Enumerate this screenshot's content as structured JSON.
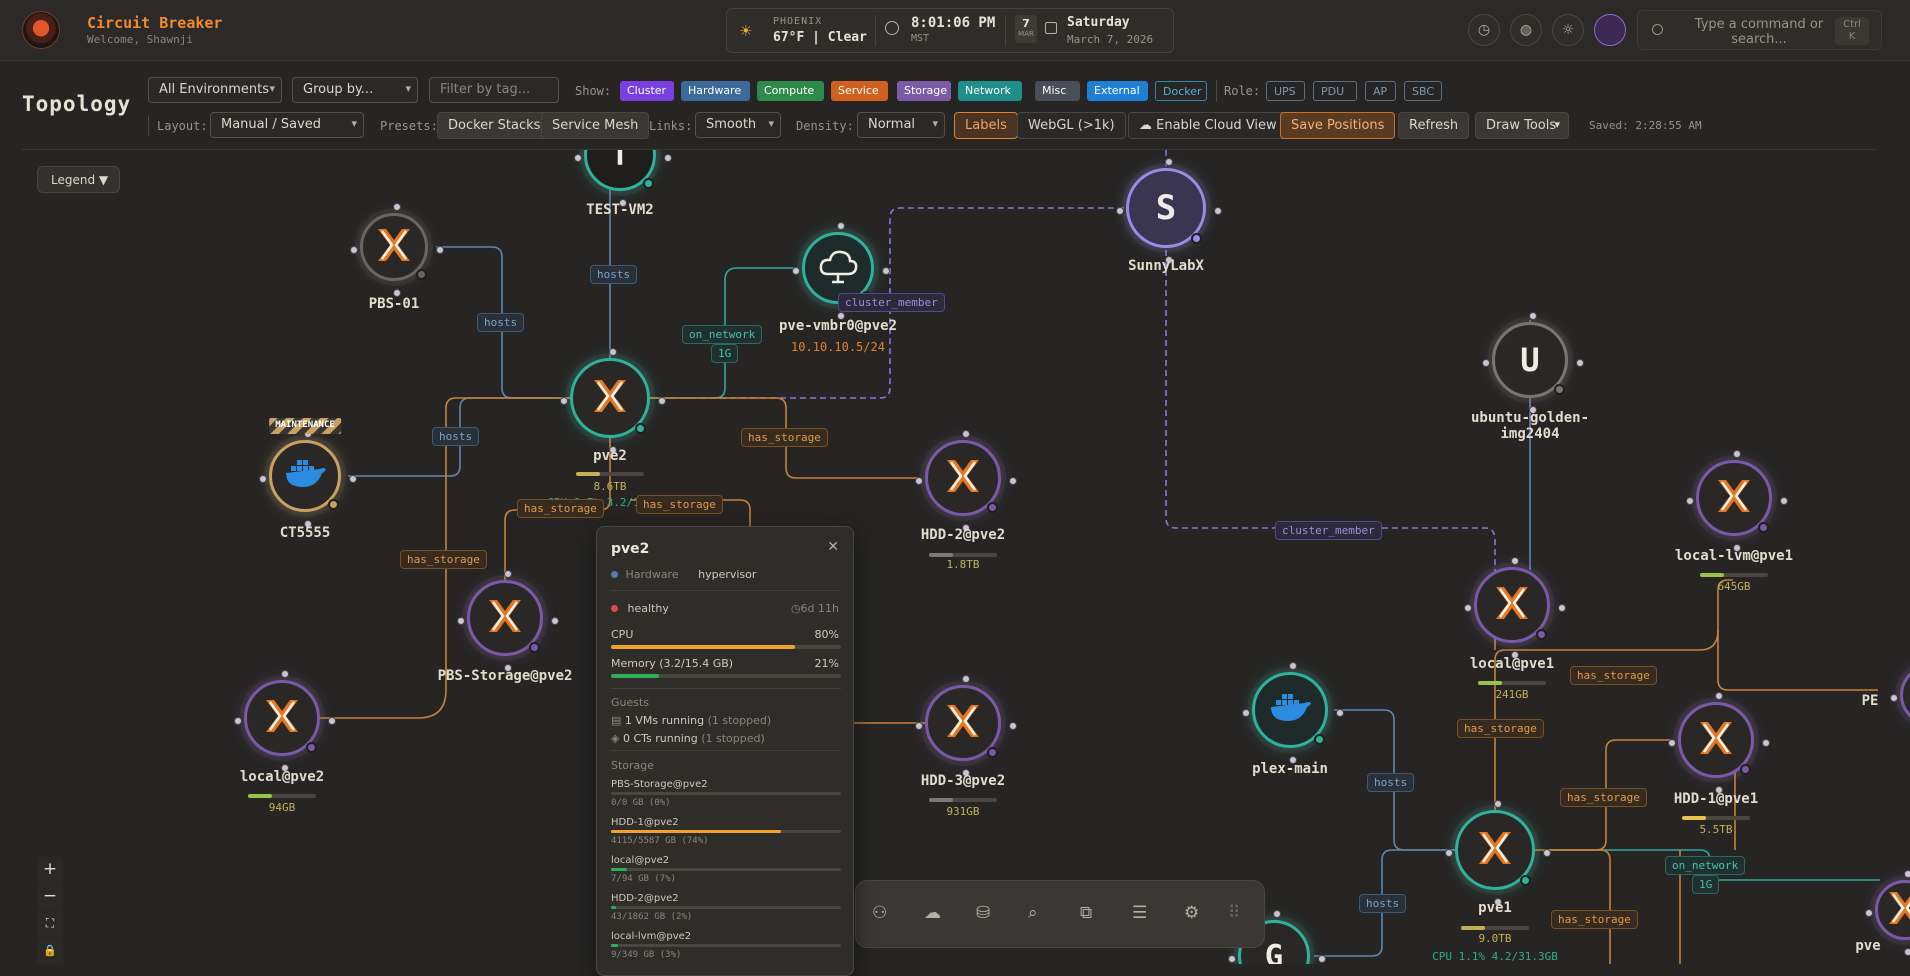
{
  "header": {
    "app_title": "Circuit Breaker",
    "welcome": "Welcome, Shawnji",
    "weather_city": "PHOENIX",
    "weather_line": "67°F | Clear",
    "clock_time": "8:01:06 PM",
    "clock_zone": "MST",
    "date_day_num": "7",
    "date_month_abbr": "MAR",
    "date_weekday": "Saturday",
    "date_full": "March 7, 2026",
    "command_placeholder": "Type a command or search...",
    "command_shortcut_1": "Ctrl",
    "command_shortcut_2": "K"
  },
  "toolbar": {
    "page_title": "Topology",
    "environment_select": "All Environments",
    "group_select": "Group by...",
    "tag_filter_placeholder": "Filter by tag...",
    "show_label": "Show:",
    "show_chips": [
      {
        "label": "Cluster",
        "color": "#7a3fe0"
      },
      {
        "label": "Hardware",
        "color": "#3d6a9a"
      },
      {
        "label": "Compute",
        "color": "#2e8a4a"
      },
      {
        "label": "Service",
        "color": "#d0601e"
      },
      {
        "label": "Storage",
        "color": "#7d5aa8"
      },
      {
        "label": "Network",
        "color": "#1f8f8a"
      },
      {
        "label": "Misc",
        "color": "#4a4e58"
      },
      {
        "label": "External",
        "color": "#1f7fd4"
      },
      {
        "label": "Docker",
        "color": "#1f6a82"
      }
    ],
    "role_label": "Role:",
    "role_chips": [
      "UPS",
      "PDU",
      "AP",
      "SBC"
    ],
    "layout_label": "Layout:",
    "layout_select": "Manual / Saved",
    "presets_label": "Presets:",
    "preset_buttons": [
      "Docker Stacks",
      "Service Mesh"
    ],
    "links_label": "Links:",
    "links_select": "Smooth",
    "density_label": "Density:",
    "density_select": "Normal",
    "labels_button": "Labels",
    "webgl_button": "WebGL (>1k)",
    "cloud_button": "Enable Cloud View",
    "save_positions_button": "Save Positions",
    "refresh_button": "Refresh",
    "draw_tools_button": "Draw Tools",
    "saved_status": "Saved: 2:28:55 AM"
  },
  "legend_button": "Legend",
  "nodes": [
    {
      "id": "test-vm2",
      "label": "TEST-VM2",
      "glyph": "T",
      "icon": "letter-t-icon"
    },
    {
      "id": "pbs-01",
      "label": "PBS-01",
      "icon": "proxmox-icon"
    },
    {
      "id": "pve-vmbr0",
      "label": "pve-vmbr0@pve2",
      "sub": "10.10.10.5/24",
      "icon": "cloud-network-icon"
    },
    {
      "id": "sunnylabx",
      "label": "SunnyLabX",
      "glyph": "S",
      "icon": "letter-s-icon"
    },
    {
      "id": "ubuntu",
      "label": "ubuntu-golden-img2404",
      "label_line1": "ubuntu-golden-",
      "label_line2": "img2404",
      "glyph": "U",
      "icon": "letter-u-icon"
    },
    {
      "id": "pve2",
      "label": "pve2",
      "sub": "8.6TB",
      "extra": "CPU 0.7% 3.2/15.4GB",
      "icon": "proxmox-icon"
    },
    {
      "id": "ct5555",
      "label": "CT5555",
      "badge": "MAINTENANCE",
      "icon": "docker-icon"
    },
    {
      "id": "hdd2",
      "label": "HDD-2@pve2",
      "sub": "1.8TB",
      "icon": "proxmox-icon"
    },
    {
      "id": "local-lvm-pve1",
      "label": "local-lvm@pve1",
      "sub": "645GB",
      "icon": "proxmox-icon"
    },
    {
      "id": "pbs-storage",
      "label": "PBS-Storage@pve2",
      "icon": "proxmox-icon"
    },
    {
      "id": "local-pve1",
      "label": "local@pve1",
      "sub": "241GB",
      "icon": "proxmox-icon"
    },
    {
      "id": "local-pve2",
      "label": "local@pve2",
      "sub": "94GB",
      "icon": "proxmox-icon"
    },
    {
      "id": "hdd3",
      "label": "HDD-3@pve2",
      "sub": "931GB",
      "icon": "proxmox-icon"
    },
    {
      "id": "plex",
      "label": "plex-main",
      "icon": "docker-icon"
    },
    {
      "id": "hdd1",
      "label": "HDD-1@pve1",
      "sub": "5.5TB",
      "icon": "proxmox-icon"
    },
    {
      "id": "pve1",
      "label": "pve1",
      "sub": "9.0TB",
      "extra": "CPU 1.1% 4.2/31.3GB",
      "icon": "proxmox-icon"
    },
    {
      "id": "g-node",
      "glyph": "G",
      "icon": "letter-g-icon"
    },
    {
      "id": "pve-edge",
      "label": "pve",
      "icon": "proxmox-icon"
    },
    {
      "id": "pe-edge",
      "label": "PE",
      "icon": "proxmox-icon"
    }
  ],
  "edge_labels": [
    {
      "id": "hosts-pve2-testvm",
      "text": "hosts",
      "kind": "hosts"
    },
    {
      "id": "hosts-pbs01",
      "text": "hosts",
      "kind": "hosts"
    },
    {
      "id": "hosts-ct5555",
      "text": "hosts",
      "kind": "hosts"
    },
    {
      "id": "on-network-pve2",
      "text": "on_network",
      "kind": "network"
    },
    {
      "id": "speed-1g-pve2",
      "text": "1G",
      "kind": "network"
    },
    {
      "id": "cluster-member-pve2",
      "text": "cluster_member",
      "kind": "cluster"
    },
    {
      "id": "has-storage-hdd2",
      "text": "has_storage",
      "kind": "storage"
    },
    {
      "id": "has-storage-local-pve2",
      "text": "has_storage",
      "kind": "storage"
    },
    {
      "id": "has-storage-pbs",
      "text": "has_storage",
      "kind": "storage"
    },
    {
      "id": "has-storage-hdd3",
      "text": "has_storage",
      "kind": "storage"
    },
    {
      "id": "cluster-member-pve1",
      "text": "cluster_member",
      "kind": "cluster"
    },
    {
      "id": "has-storage-local-lvm",
      "text": "has_storage",
      "kind": "storage"
    },
    {
      "id": "has-storage-local-pve1",
      "text": "has_storage",
      "kind": "storage"
    },
    {
      "id": "has-storage-hdd1",
      "text": "has_storage",
      "kind": "storage"
    },
    {
      "id": "hosts-plex",
      "text": "hosts",
      "kind": "hosts"
    },
    {
      "id": "on-network-pve1",
      "text": "on_network",
      "kind": "network"
    },
    {
      "id": "speed-1g-pve1",
      "text": "1G",
      "kind": "network"
    },
    {
      "id": "hosts-g",
      "text": "hosts",
      "kind": "hosts"
    },
    {
      "id": "has-storage-pve1-right",
      "text": "has_storage",
      "kind": "storage"
    }
  ],
  "popover": {
    "title": "pve2",
    "category": "Hardware",
    "role": "hypervisor",
    "status": "healthy",
    "uptime": "6d 11h",
    "cpu_label": "CPU",
    "cpu_value": "80%",
    "cpu_fraction": 0.8,
    "memory_label": "Memory (3.2/15.4 GB)",
    "memory_value": "21%",
    "memory_fraction": 0.21,
    "guests_heading": "Guests",
    "vms_running": "1 VMs running",
    "vms_stopped": "(1 stopped)",
    "cts_running": "0 CTs running",
    "cts_stopped": "(1 stopped)",
    "storage_heading": "Storage",
    "storage": [
      {
        "name": "PBS-Storage@pve2",
        "detail": "0/0 GB (0%)",
        "fraction": 0.0,
        "color": "#5b5650"
      },
      {
        "name": "HDD-1@pve2",
        "detail": "4115/5587 GB (74%)",
        "fraction": 0.74,
        "color": "#f0a32c"
      },
      {
        "name": "local@pve2",
        "detail": "7/94 GB (7%)",
        "fraction": 0.07,
        "color": "#2fae5a"
      },
      {
        "name": "HDD-2@pve2",
        "detail": "43/1862 GB (2%)",
        "fraction": 0.02,
        "color": "#2fae5a"
      },
      {
        "name": "local-lvm@pve2",
        "detail": "9/349 GB (3%)",
        "fraction": 0.03,
        "color": "#2fae5a"
      }
    ]
  },
  "zoom_controls": {
    "in": "+",
    "out": "−"
  }
}
